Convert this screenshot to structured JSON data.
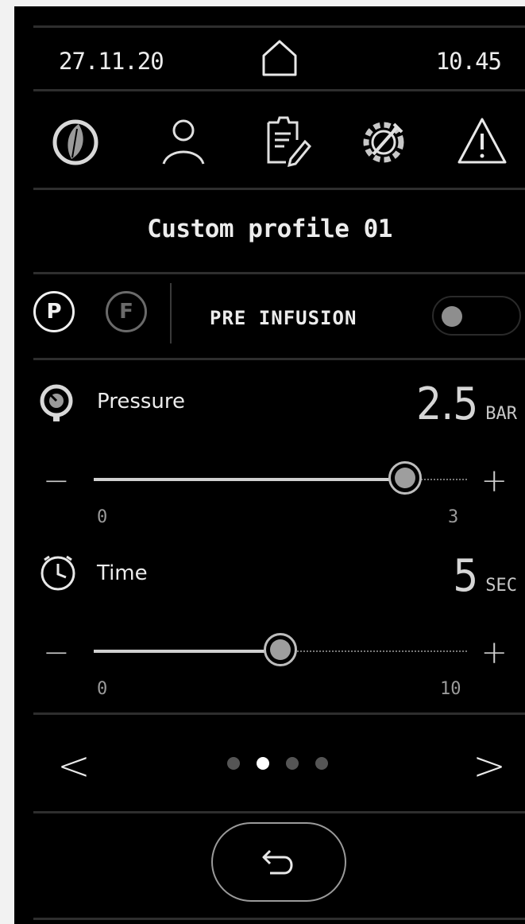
{
  "status_bar": {
    "date": "27.11.20",
    "time": "10.45"
  },
  "nav_icons": [
    "leaf-icon",
    "user-icon",
    "clipboard-edit-icon",
    "settings-tool-icon",
    "warning-icon"
  ],
  "profile": {
    "title": "Custom profile 01"
  },
  "mode": {
    "p_label": "P",
    "f_label": "F",
    "selected": "P",
    "pre_infusion_label": "PRE INFUSION",
    "pre_infusion_on": false
  },
  "pressure": {
    "label": "Pressure",
    "value": "2.5",
    "unit": "BAR",
    "min": "0",
    "max": "3",
    "minus": "−",
    "plus": "+",
    "level": 0.833
  },
  "time": {
    "label": "Time",
    "value": "5",
    "unit": "SEC",
    "min": "0",
    "max": "10",
    "minus": "−",
    "plus": "+",
    "level": 0.5
  },
  "pager": {
    "prev": "<",
    "next": ">",
    "pages": 4,
    "current": 2
  },
  "colors": {
    "background": "#000000",
    "text": "#ececec",
    "inactive": "#555555",
    "track": "#d0d0d0"
  }
}
